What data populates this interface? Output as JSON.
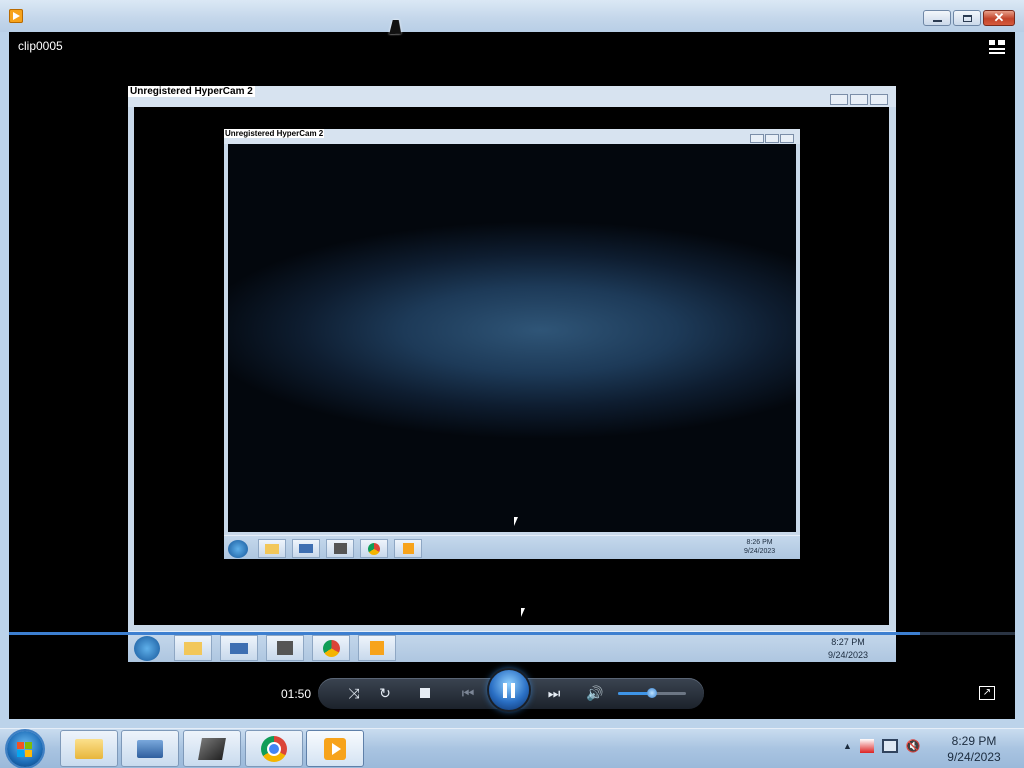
{
  "window": {
    "title_icon": "media-player-icon",
    "minimize": "minimize-icon",
    "maximize": "maximize-icon",
    "close": "close-icon"
  },
  "player": {
    "clip_title": "clip0005",
    "elapsed_time": "01:50",
    "progress": 0.906,
    "volume": 0.5
  },
  "recording": {
    "outer_title": "Unregistered HyperCam 2",
    "inner_title": "Unregistered HyperCam 2",
    "outer_clock": {
      "time": "8:27 PM",
      "date": "9/24/2023"
    },
    "inner_clock": {
      "time": "8:26 PM",
      "date": "9/24/2023"
    }
  },
  "controls": {
    "shuffle": "shuffle-icon",
    "repeat": "repeat-icon",
    "stop": "stop-icon",
    "previous": "previous-icon",
    "pause": "pause-icon",
    "next": "next-icon",
    "mute": "speaker-icon"
  },
  "taskbar": {
    "items": [
      "file-explorer-icon",
      "on-screen-keyboard-icon",
      "hypercam-icon",
      "chrome-icon",
      "media-player-icon"
    ],
    "tray": [
      "show-hidden-icons",
      "action-center-icon",
      "network-icon",
      "volume-muted-icon"
    ],
    "clock_time": "8:29 PM",
    "clock_date": "9/24/2023"
  },
  "colors": {
    "accent": "#3d7fd0",
    "taskbar": "#a9c4e1",
    "player_bg": "#000000"
  }
}
